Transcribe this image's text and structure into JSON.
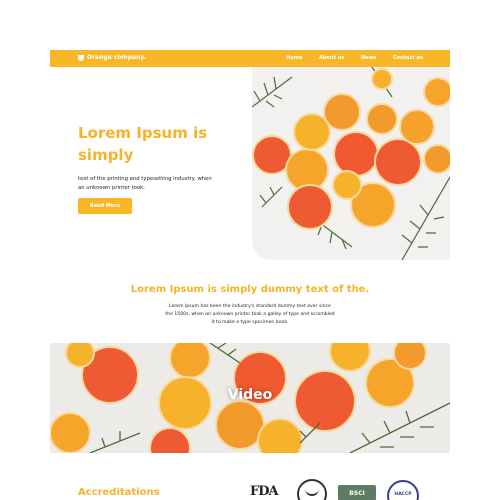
{
  "header": {
    "brand": "Orange company.",
    "nav": [
      "Home",
      "About us",
      "News",
      "Contact us"
    ]
  },
  "hero": {
    "title": "Lorem Ipsum is simply",
    "text": "text of the printing and typesetting industry. when an unknown printer took.",
    "button": "Read More"
  },
  "intro": {
    "title": "Lorem Ipsum is simply dummy text of the.",
    "text": "Lorem Ipsum has been the industry's standard dummy text ever since the 1500s, when an unknown printer took a galley of type and scrambled it to make a type specimen book."
  },
  "video": {
    "label": "Video"
  },
  "accreditations": {
    "title": "Accreditations",
    "logos": [
      "FDA",
      "Halal",
      "BSCI",
      "HACCP"
    ]
  },
  "colors": {
    "accent": "#f9b727",
    "heading": "#f7b22c",
    "orange_slice": "#f39a2c",
    "blood_orange": "#ee5a33",
    "rosemary": "#4f6b3c"
  }
}
